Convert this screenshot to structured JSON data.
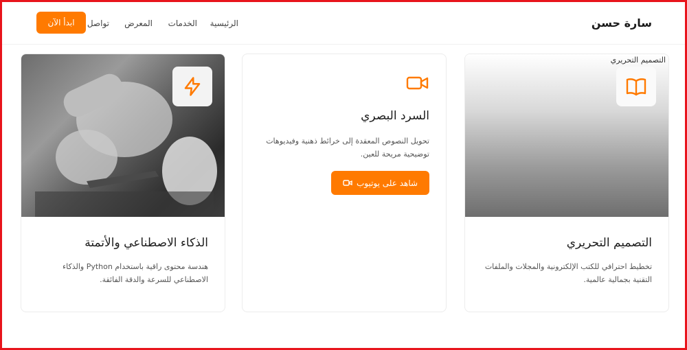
{
  "header": {
    "brand": "سارة حسن",
    "nav": {
      "home": "الرئيسية",
      "services": "الخدمات",
      "gallery": "المعرض",
      "contact": "تواصل"
    },
    "cta": "ابدأ الآن"
  },
  "cards": {
    "ai": {
      "icon": "lightning-icon",
      "title": "الذكاء الاصطناعي والأتمتة",
      "description": "هندسة محتوى راقية باستخدام Python والذكاء الاصطناعي للسرعة والدقة الفائقة."
    },
    "visual": {
      "icon": "video-camera-icon",
      "title": "السرد البصري",
      "description": "تحويل النصوص المعقدة إلى خرائط ذهنية وفيديوهات توضيحية مريحة للعين.",
      "button": "شاهد على يوتيوب"
    },
    "editorial": {
      "icon": "book-icon",
      "image_alt": "التصميم التحريري",
      "title": "التصميم التحريري",
      "description": "تخطيط احترافي للكتب الإلكترونية والمجلات والملفات التقنية بجمالية عالمية."
    }
  },
  "colors": {
    "accent": "#ff7a00",
    "frame": "#e8141c"
  }
}
